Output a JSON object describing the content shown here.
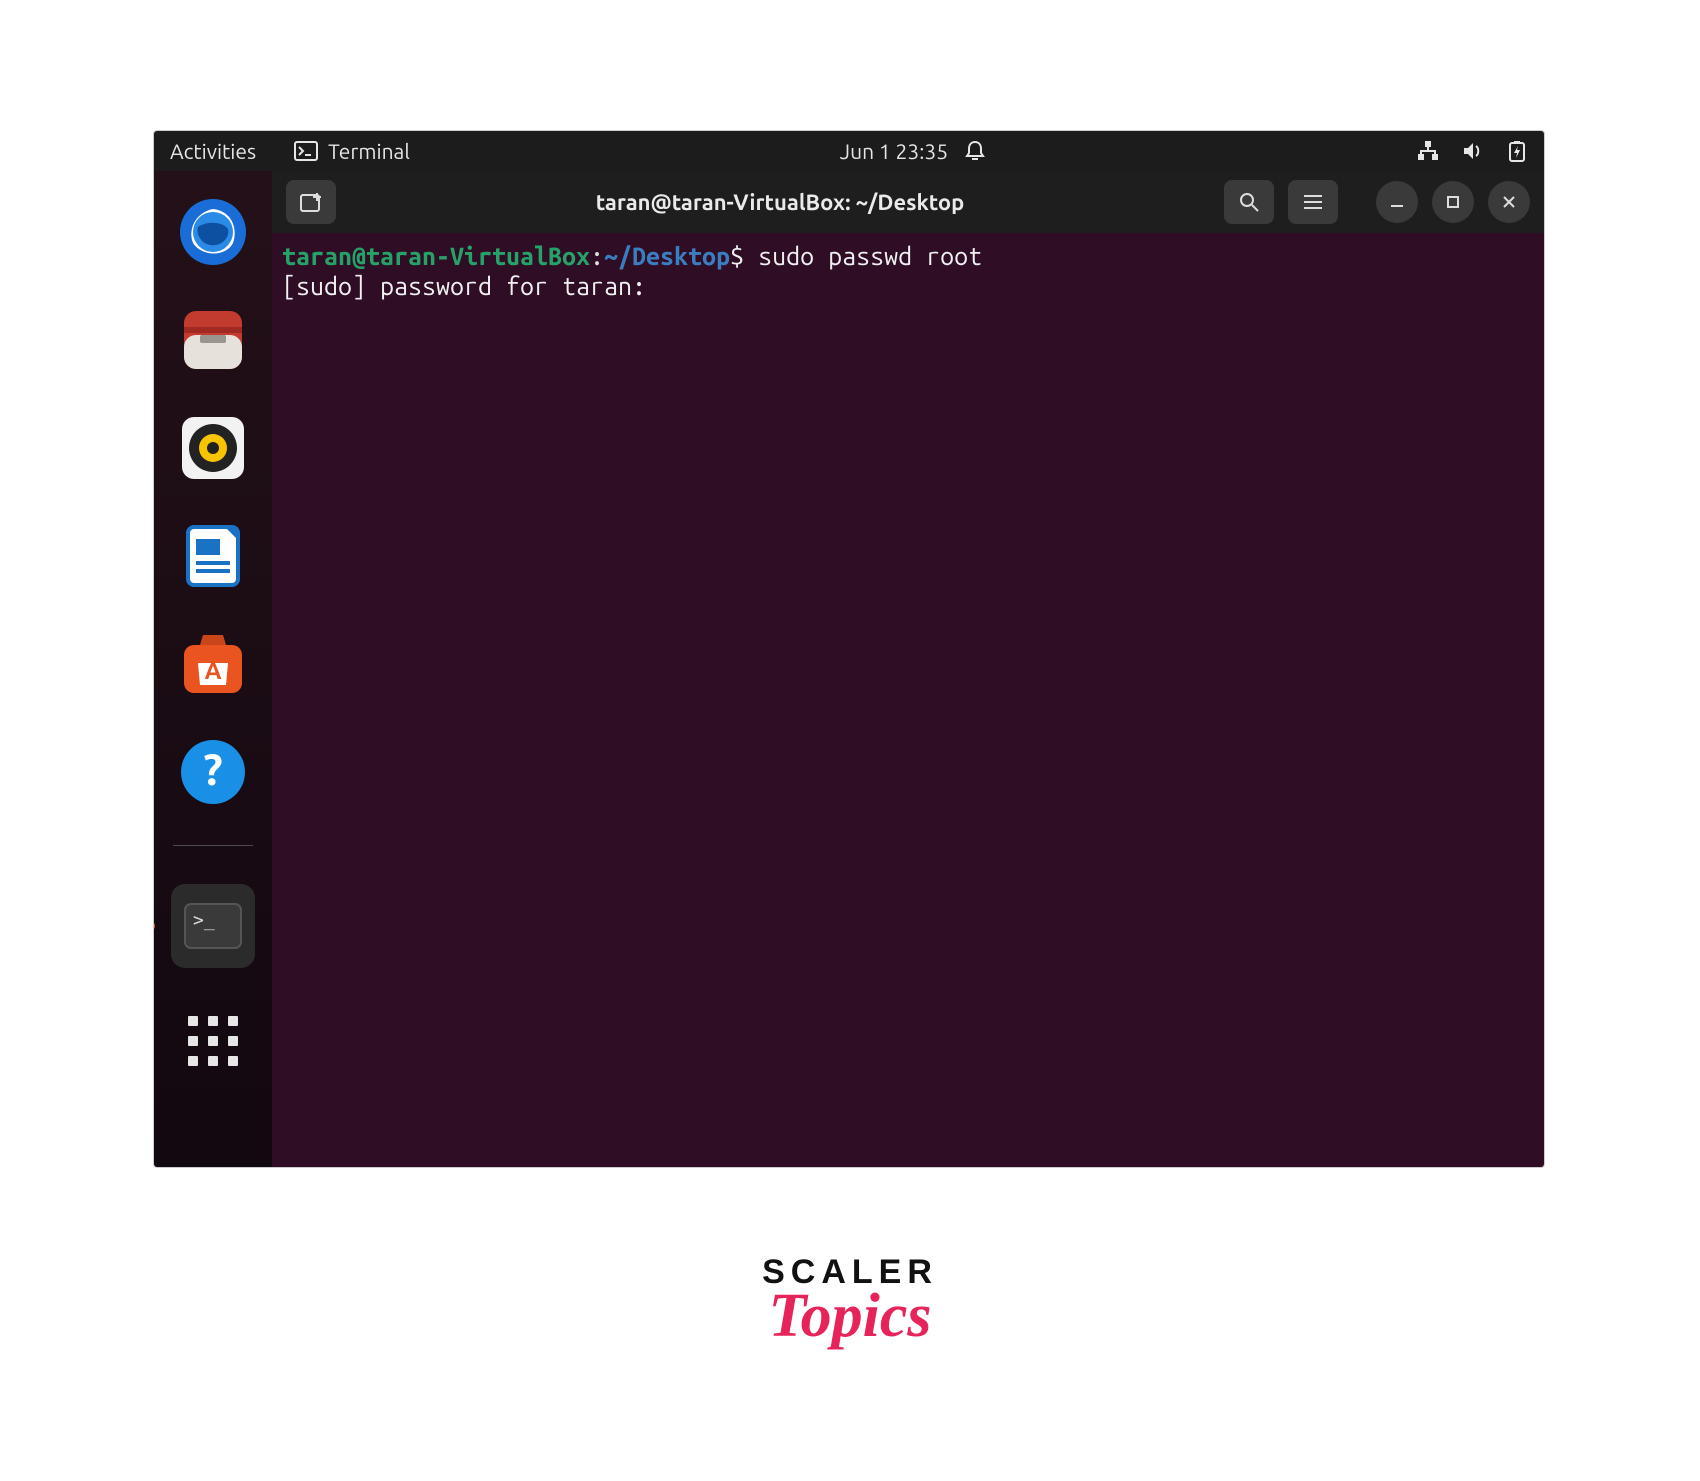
{
  "topbar": {
    "activities": "Activities",
    "app": "Terminal",
    "datetime": "Jun 1  23:35"
  },
  "window": {
    "title": "taran@taran-VirtualBox: ~/Desktop"
  },
  "terminal": {
    "prompt_user": "taran@taran-VirtualBox",
    "prompt_sep": ":",
    "prompt_path": "~/Desktop",
    "prompt_end": "$ ",
    "command": "sudo passwd root",
    "line2": "[sudo] password for taran:"
  },
  "dock": {
    "items": [
      {
        "name": "thunderbird"
      },
      {
        "name": "files"
      },
      {
        "name": "rhythmbox"
      },
      {
        "name": "libreoffice-writer"
      },
      {
        "name": "software"
      },
      {
        "name": "help"
      },
      {
        "name": "terminal",
        "active": true
      },
      {
        "name": "apps-grid"
      }
    ]
  },
  "brand": {
    "line1": "SCALER",
    "line2": "Topics"
  }
}
